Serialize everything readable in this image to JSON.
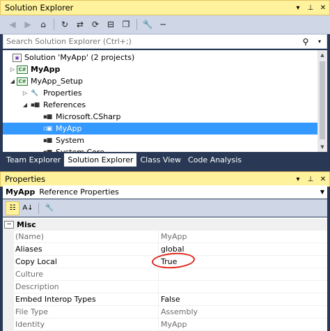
{
  "solution_explorer": {
    "title": "Solution Explorer",
    "controls": {
      "dropdown": "▾",
      "pin": "⊥",
      "close": "✕"
    },
    "search": {
      "placeholder": "Search Solution Explorer (Ctrl+;)"
    },
    "tree": [
      {
        "label": "Solution 'MyApp' (2 projects)",
        "icon": "solution-icon",
        "expander": "",
        "bold": false
      },
      {
        "label": "MyApp",
        "icon": "csharp-project-icon",
        "expander": "▷",
        "bold": true
      },
      {
        "label": "MyApp_Setup",
        "icon": "csharp-project-icon",
        "expander": "◢",
        "bold": false
      },
      {
        "label": "Properties",
        "icon": "wrench-icon",
        "expander": "▷",
        "bold": false
      },
      {
        "label": "References",
        "icon": "references-icon",
        "expander": "◢",
        "bold": false
      },
      {
        "label": "Microsoft.CSharp",
        "icon": "reference-icon",
        "expander": "",
        "bold": false
      },
      {
        "label": "MyApp",
        "icon": "project-reference-icon",
        "expander": "",
        "bold": false,
        "selected": true
      },
      {
        "label": "System",
        "icon": "reference-icon",
        "expander": "",
        "bold": false
      },
      {
        "label": "System.Core",
        "icon": "reference-icon",
        "expander": "",
        "bold": false
      }
    ]
  },
  "tabs": [
    {
      "label": "Team Explorer",
      "active": false
    },
    {
      "label": "Solution Explorer",
      "active": true
    },
    {
      "label": "Class View",
      "active": false
    },
    {
      "label": "Code Analysis",
      "active": false
    }
  ],
  "properties": {
    "title": "Properties",
    "object_name": "MyApp",
    "object_type": "Reference Properties",
    "category": {
      "toggle": "−",
      "label": "Misc"
    },
    "rows": [
      {
        "name": "(Name)",
        "value": "MyApp",
        "readonly": true
      },
      {
        "name": "Aliases",
        "value": "global",
        "readonly": false
      },
      {
        "name": "Copy Local",
        "value": "True",
        "readonly": false
      },
      {
        "name": "Culture",
        "value": "",
        "readonly": true
      },
      {
        "name": "Description",
        "value": "",
        "readonly": true
      },
      {
        "name": "Embed Interop Types",
        "value": "False",
        "readonly": false
      },
      {
        "name": "File Type",
        "value": "Assembly",
        "readonly": true
      },
      {
        "name": "Identity",
        "value": "MyApp",
        "readonly": true
      }
    ]
  },
  "colors": {
    "frame": "#293955",
    "active_title": "#fff29d",
    "selection": "#3399ff",
    "annotation": "#e0241b"
  }
}
